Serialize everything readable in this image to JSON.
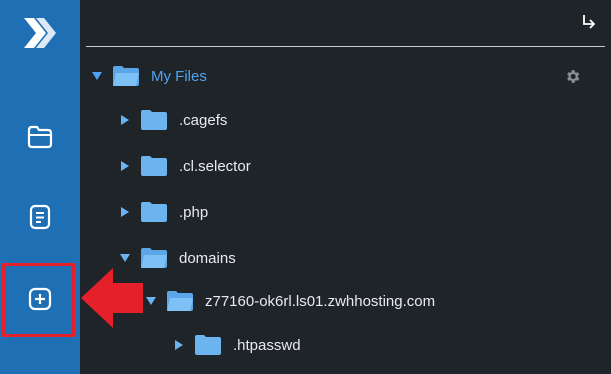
{
  "colors": {
    "sidebar": "#1f6fb5",
    "background": "#1f2429",
    "accent": "#4da3ef",
    "folder": "#6cb4f0",
    "highlight": "#e5202a"
  },
  "sidebar": {
    "logo_icon": "app-logo-icon",
    "items": [
      {
        "icon": "folder-icon"
      },
      {
        "icon": "document-icon"
      },
      {
        "icon": "add-icon"
      }
    ]
  },
  "header": {
    "logout_icon": "logout-arrow-icon",
    "settings_icon": "gear-icon"
  },
  "tree": {
    "root": {
      "label": "My Files",
      "expanded": true
    },
    "items": [
      {
        "label": ".cagefs",
        "expanded": false,
        "depth": 1
      },
      {
        "label": ".cl.selector",
        "expanded": false,
        "depth": 1
      },
      {
        "label": ".php",
        "expanded": false,
        "depth": 1
      },
      {
        "label": "domains",
        "expanded": true,
        "depth": 1
      },
      {
        "label": "z77160-ok6rl.ls01.zwhhosting.com",
        "expanded": true,
        "depth": 2
      },
      {
        "label": ".htpasswd",
        "expanded": false,
        "depth": 3
      }
    ]
  }
}
